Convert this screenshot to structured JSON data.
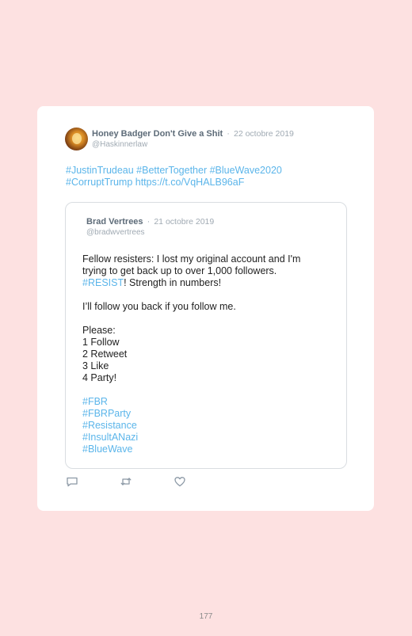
{
  "tweet": {
    "author_name": "Honey Badger Don't Give a Shit",
    "separator": "·",
    "date": "22 octobre 2019",
    "handle": "@Haskinnerlaw",
    "text_line1": "#JustinTrudeau #BetterTogether #BlueWave2020",
    "text_line2": "#CorruptTrump https://t.co/VqHALB96aF"
  },
  "quoted_tweet": {
    "author_name": "Brad Vertrees",
    "separator": "·",
    "date": "21 octobre 2019",
    "handle": "@bradwvertrees",
    "line1": "Fellow resisters: I lost my original account and I'm",
    "line2": "trying to get back up to over 1,000 followers.",
    "line3_tag": "#RESIST",
    "line3_rest": "! Strength in numbers!",
    "line4": "I’ll follow you back if you follow me.",
    "please": "Please:",
    "steps": [
      "1 Follow",
      "2 Retweet",
      "3 Like",
      "4 Party!"
    ],
    "hashtags": [
      "#FBR",
      "#FBRParty",
      "#Resistance",
      "#InsultANazi",
      "#BlueWave"
    ]
  },
  "actions": {
    "reply_icon": "reply-icon",
    "retweet_icon": "retweet-icon",
    "like_icon": "heart-icon"
  },
  "colors": {
    "background": "#fde1e1",
    "link": "#5bb5ea",
    "muted": "#a0aab3"
  },
  "page_number": "177"
}
